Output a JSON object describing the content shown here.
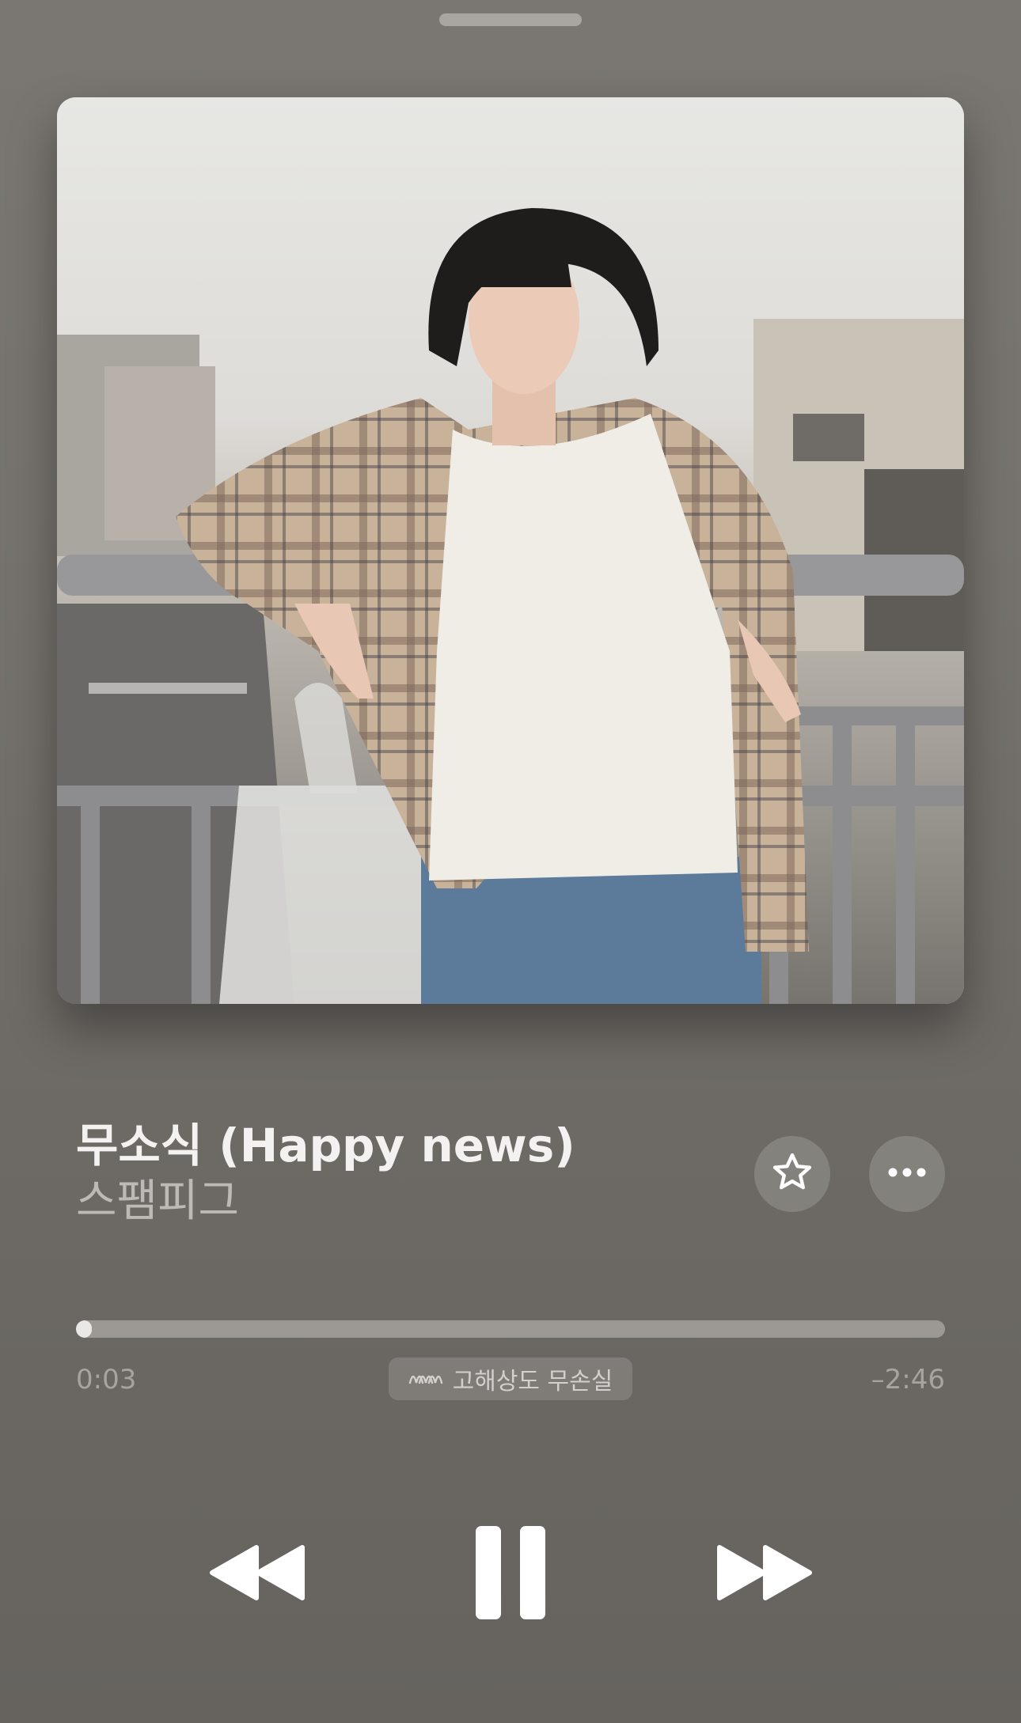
{
  "now_playing": {
    "title": "무소식 (Happy news)",
    "artist": "스팸피그",
    "progress_fraction": 0.018
  },
  "playback": {
    "elapsed": "0:03",
    "remaining": "–2:46",
    "quality_label": "고해상도 무손실",
    "quality_icon": "lossless-waveform-icon",
    "state": "playing"
  },
  "actions": {
    "favorite_icon": "star-icon",
    "more_icon": "ellipsis-icon"
  },
  "controls": {
    "previous_icon": "rewind-icon",
    "play_pause_icon": "pause-icon",
    "next_icon": "fast-forward-icon"
  },
  "colors": {
    "background": "#76736e",
    "primary_text": "#f3f2f0",
    "secondary_text": "#bcbab6",
    "progress_fill": "#e9e8e6",
    "progress_track": "#9c9994"
  }
}
